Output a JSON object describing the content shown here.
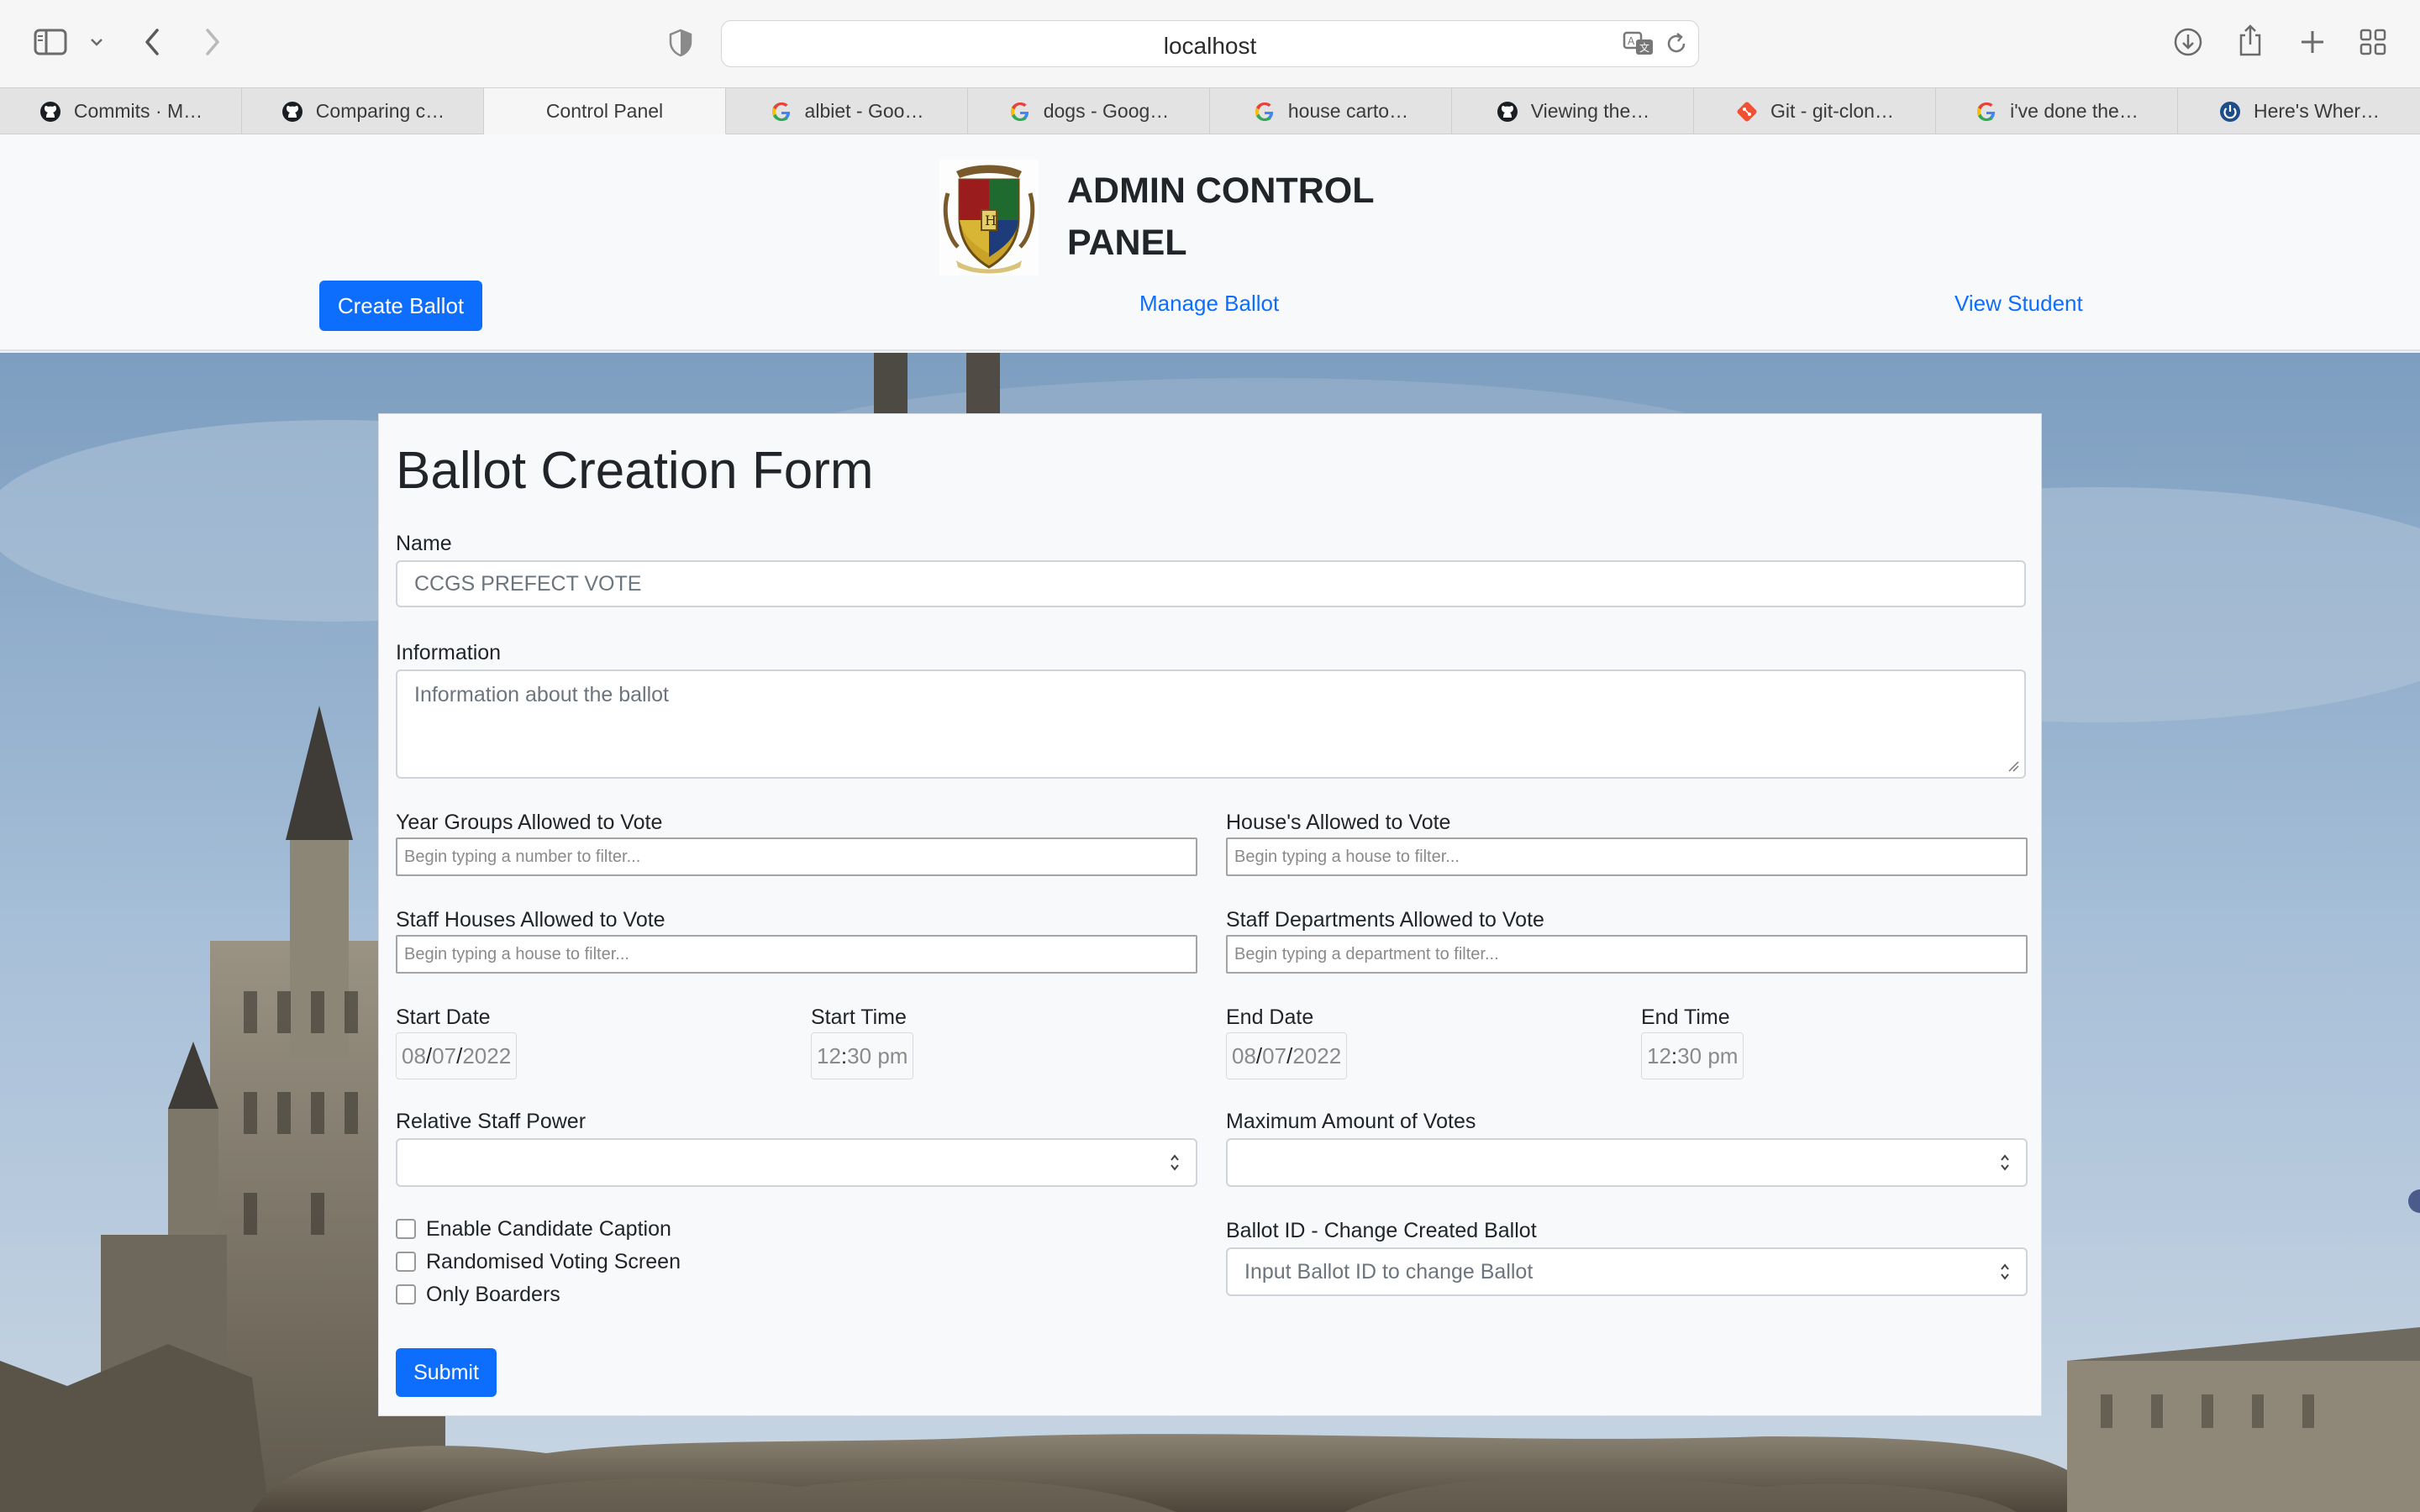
{
  "browser": {
    "url": "localhost",
    "tabs": [
      {
        "label": "Commits · M…",
        "icon": "github-icon"
      },
      {
        "label": "Comparing c…",
        "icon": "github-icon"
      },
      {
        "label": "Control Panel",
        "icon": "none",
        "active": true
      },
      {
        "label": "albiet - Goo…",
        "icon": "google-icon"
      },
      {
        "label": "dogs - Goog…",
        "icon": "google-icon"
      },
      {
        "label": "house carto…",
        "icon": "google-icon"
      },
      {
        "label": "Viewing the…",
        "icon": "github-icon"
      },
      {
        "label": "Git - git-clon…",
        "icon": "git-icon"
      },
      {
        "label": "i've done the…",
        "icon": "google-icon"
      },
      {
        "label": "Here's Wher…",
        "icon": "power-icon"
      }
    ]
  },
  "header": {
    "title": "ADMIN CONTROL\nPANEL",
    "create_ballot": "Create Ballot",
    "manage_ballot": "Manage Ballot",
    "view_student": "View Student"
  },
  "form": {
    "title": "Ballot Creation Form",
    "name_label": "Name",
    "name_placeholder": "CCGS PREFECT VOTE",
    "info_label": "Information",
    "info_placeholder": "Information about the ballot",
    "year_groups_label": "Year Groups Allowed to Vote",
    "year_groups_placeholder": "Begin typing a number to filter...",
    "houses_label": "House's Allowed to Vote",
    "houses_placeholder": "Begin typing a house to filter...",
    "staff_houses_label": "Staff Houses Allowed to Vote",
    "staff_houses_placeholder": "Begin typing a house to filter...",
    "staff_depts_label": "Staff Departments Allowed to Vote",
    "staff_depts_placeholder": "Begin typing a department to filter...",
    "start_date_label": "Start Date",
    "start_date": {
      "mm": "08",
      "dd": "07",
      "yyyy": "2022"
    },
    "start_time_label": "Start Time",
    "start_time": {
      "hh": "12",
      "mm": "30",
      "ampm": "pm"
    },
    "end_date_label": "End Date",
    "end_date": {
      "mm": "08",
      "dd": "07",
      "yyyy": "2022"
    },
    "end_time_label": "End Time",
    "end_time": {
      "hh": "12",
      "mm": "30",
      "ampm": "pm"
    },
    "staff_power_label": "Relative Staff Power",
    "max_votes_label": "Maximum Amount of Votes",
    "checkbox_caption": "Enable Candidate Caption",
    "checkbox_random": "Randomised Voting Screen",
    "checkbox_boarders": "Only Boarders",
    "ballot_id_label": "Ballot ID - Change Created Ballot",
    "ballot_id_placeholder": "Input Ballot ID to change Ballot",
    "submit": "Submit"
  },
  "colors": {
    "primary": "#0d6efd",
    "header_bg": "#f8f9fa",
    "sky": "#8fb1d0"
  }
}
